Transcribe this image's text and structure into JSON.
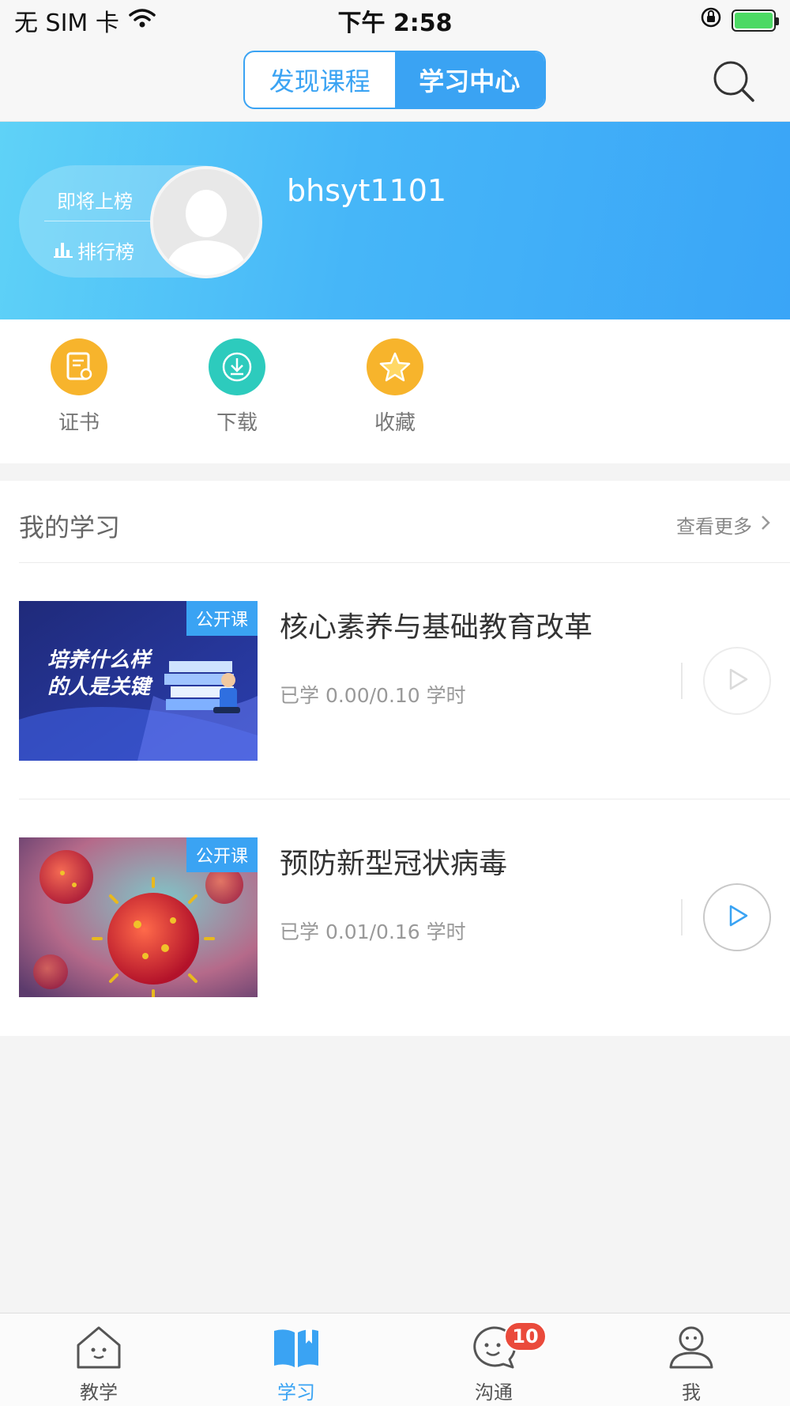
{
  "status_bar": {
    "carrier": "无 SIM 卡",
    "time": "下午 2:58"
  },
  "nav": {
    "tabs": [
      {
        "label": "发现课程",
        "active": false
      },
      {
        "label": "学习中心",
        "active": true
      }
    ],
    "search_icon": "search-icon"
  },
  "profile": {
    "rank_soon": "即将上榜",
    "rank_link": "排行榜",
    "username": "bhsyt1101"
  },
  "quick_actions": [
    {
      "label": "证书",
      "icon": "certificate-icon",
      "color": "#f7b42c"
    },
    {
      "label": "下载",
      "icon": "download-icon",
      "color": "#2dcbbd"
    },
    {
      "label": "收藏",
      "icon": "star-icon",
      "color": "#f7b42c"
    }
  ],
  "learning": {
    "title": "我的学习",
    "see_more": "查看更多",
    "courses": [
      {
        "tag": "公开课",
        "title": "核心素养与基础教育改革",
        "progress": "已学 0.00/0.10 学时",
        "thumb_text_1": "培养什么样",
        "thumb_text_2": "的人是关键"
      },
      {
        "tag": "公开课",
        "title": "预防新型冠状病毒",
        "progress": "已学 0.01/0.16 学时"
      }
    ]
  },
  "tab_bar": {
    "items": [
      {
        "label": "教学",
        "icon": "house-icon"
      },
      {
        "label": "学习",
        "icon": "book-icon",
        "active": true
      },
      {
        "label": "沟通",
        "icon": "chat-icon",
        "badge": "10"
      },
      {
        "label": "我",
        "icon": "person-icon"
      }
    ]
  },
  "colors": {
    "accent": "#3aa3f3",
    "badge": "#ea4a3b",
    "orange": "#f7b42c",
    "teal": "#2dcbbd"
  }
}
